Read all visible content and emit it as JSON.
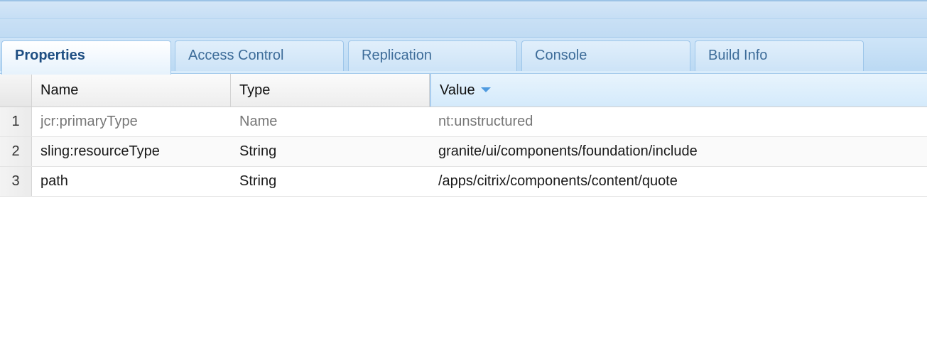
{
  "tabs": [
    {
      "label": "Properties",
      "active": true
    },
    {
      "label": "Access Control",
      "active": false
    },
    {
      "label": "Replication",
      "active": false
    },
    {
      "label": "Console",
      "active": false
    },
    {
      "label": "Build Info",
      "active": false
    }
  ],
  "grid": {
    "columns": {
      "name": "Name",
      "type": "Type",
      "value": "Value"
    },
    "sort": {
      "column": "value",
      "icon": "sort-descending-icon"
    },
    "rows": [
      {
        "num": "1",
        "name": "jcr:primaryType",
        "type": "Name",
        "value": "nt:unstructured",
        "readonly": true
      },
      {
        "num": "2",
        "name": "sling:resourceType",
        "type": "String",
        "value": "granite/ui/components/foundation/include",
        "readonly": false
      },
      {
        "num": "3",
        "name": "path",
        "type": "String",
        "value": "/apps/citrix/components/content/quote",
        "readonly": false
      }
    ]
  },
  "colors": {
    "accent": "#4f9be0",
    "tab_active_text": "#1e4e82",
    "tab_text": "#3d6c99",
    "readonly_text": "#777777"
  }
}
